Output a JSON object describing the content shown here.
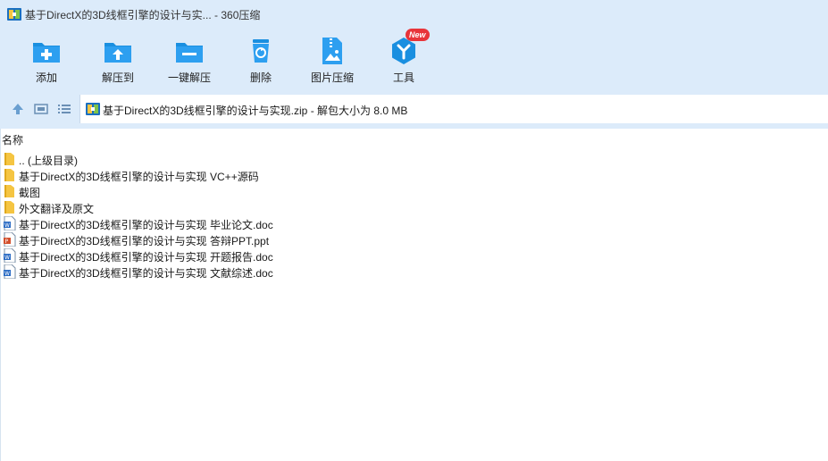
{
  "window": {
    "title": "基于DirectX的3D线框引擎的设计与实... - 360压缩"
  },
  "toolbar": {
    "items": [
      {
        "label": "添加",
        "icon": "add-icon"
      },
      {
        "label": "解压到",
        "icon": "extract-to-icon"
      },
      {
        "label": "一键解压",
        "icon": "one-click-extract-icon"
      },
      {
        "label": "删除",
        "icon": "delete-icon"
      },
      {
        "label": "图片压缩",
        "icon": "image-compress-icon"
      },
      {
        "label": "工具",
        "icon": "tools-icon",
        "badge": "New"
      }
    ]
  },
  "address": {
    "path": "基于DirectX的3D线框引擎的设计与实现.zip - 解包大小为 8.0 MB"
  },
  "columns": {
    "name": "名称"
  },
  "files": [
    {
      "name": ".. (上级目录)",
      "type": "folder"
    },
    {
      "name": "基于DirectX的3D线框引擎的设计与实现 VC++源码",
      "type": "folder"
    },
    {
      "name": "截图",
      "type": "folder"
    },
    {
      "name": "外文翻译及原文",
      "type": "folder"
    },
    {
      "name": "基于DirectX的3D线框引擎的设计与实现 毕业论文.doc",
      "type": "doc"
    },
    {
      "name": "基于DirectX的3D线框引擎的设计与实现 答辩PPT.ppt",
      "type": "ppt"
    },
    {
      "name": "基于DirectX的3D线框引擎的设计与实现 开题报告.doc",
      "type": "doc"
    },
    {
      "name": "基于DirectX的3D线框引擎的设计与实现 文献综述.doc",
      "type": "doc"
    }
  ],
  "colors": {
    "accent": "#1a8fe0",
    "top_background": "#dcebfa",
    "folder": "#f5c542",
    "badge": "#e8343a"
  }
}
